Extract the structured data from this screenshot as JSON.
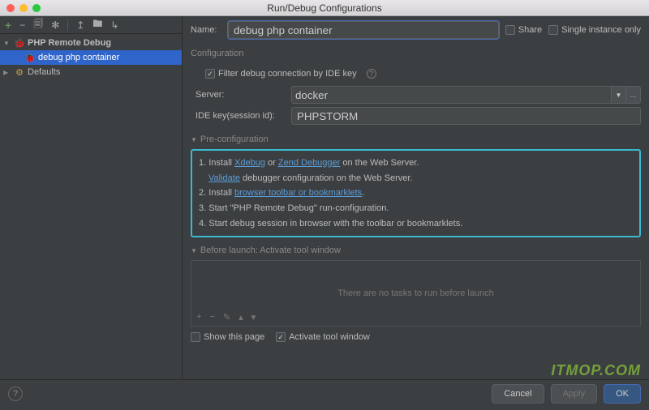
{
  "title": "Run/Debug Configurations",
  "tree": {
    "root": "PHP Remote Debug",
    "config": "debug php container",
    "defaults": "Defaults"
  },
  "form": {
    "name_label": "Name:",
    "name_value": "debug php container",
    "share": "Share",
    "single_instance": "Single instance only",
    "configuration": "Configuration",
    "filter_label": "Filter debug connection by IDE key",
    "server_label": "Server:",
    "server_value": "docker",
    "ide_key_label": "IDE key(session id):",
    "ide_key_value": "PHPSTORM"
  },
  "precfg": {
    "title": "Pre-configuration",
    "l1a": "1. Install ",
    "xdebug": "Xdebug",
    "or": " or ",
    "zend": "Zend Debugger",
    "l1b": " on the Web Server.",
    "validate": "Validate",
    "l1c": " debugger configuration on the Web Server.",
    "l2a": "2. Install ",
    "toolbar": "browser toolbar or bookmarklets",
    "l2b": ".",
    "l3": "3. Start \"PHP Remote Debug\" run-configuration.",
    "l4": "4. Start debug session in browser with the toolbar or bookmarklets."
  },
  "before_launch": {
    "title": "Before launch: Activate tool window",
    "empty": "There are no tasks to run before launch",
    "show_page": "Show this page",
    "activate": "Activate tool window"
  },
  "buttons": {
    "cancel": "Cancel",
    "apply": "Apply",
    "ok": "OK"
  },
  "watermark": "ITMOP.COM"
}
